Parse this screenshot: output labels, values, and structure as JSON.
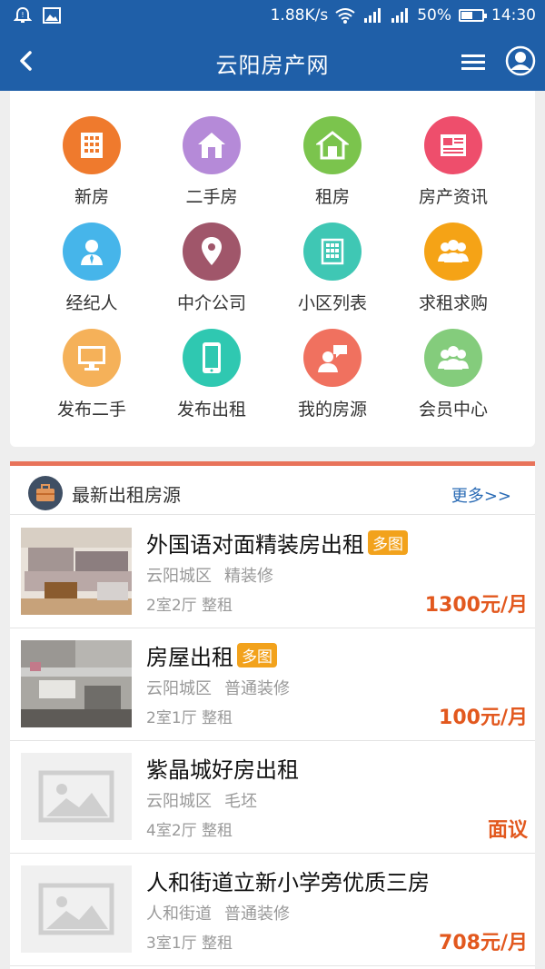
{
  "status": {
    "speed": "1.88K/s",
    "battery": "50%",
    "time": "14:30"
  },
  "header": {
    "title": "云阳房产网"
  },
  "grid": [
    {
      "label": "新房",
      "icon": "building-icon",
      "color": "#ef7a2d"
    },
    {
      "label": "二手房",
      "icon": "house-icon",
      "color": "#b58ad8"
    },
    {
      "label": "租房",
      "icon": "home-icon",
      "color": "#7bc44d"
    },
    {
      "label": "房产资讯",
      "icon": "newspaper-icon",
      "color": "#ee4e6c"
    },
    {
      "label": "经纪人",
      "icon": "agent-icon",
      "color": "#46b5ea"
    },
    {
      "label": "中介公司",
      "icon": "location-pin-icon",
      "color": "#a0566a"
    },
    {
      "label": "小区列表",
      "icon": "grid-building-icon",
      "color": "#3fc7b4"
    },
    {
      "label": "求租求购",
      "icon": "group-icon",
      "color": "#f5a316"
    },
    {
      "label": "发布二手",
      "icon": "monitor-icon",
      "color": "#f5b159"
    },
    {
      "label": "发布出租",
      "icon": "phone-icon",
      "color": "#2fc8b1"
    },
    {
      "label": "我的房源",
      "icon": "chat-person-icon",
      "color": "#f0715f"
    },
    {
      "label": "会员中心",
      "icon": "members-icon",
      "color": "#84cc7c"
    }
  ],
  "rentals": {
    "title": "最新出租房源",
    "more": "更多>>",
    "items": [
      {
        "title": "外国语对面精装房出租",
        "tag": "多图",
        "district": "云阳城区",
        "decor": "精装修",
        "layout": "2室2厅",
        "type": "整租",
        "price": "1300元/月",
        "image": "photo"
      },
      {
        "title": "房屋出租",
        "tag": "多图",
        "district": "云阳城区",
        "decor": "普通装修",
        "layout": "2室1厅",
        "type": "整租",
        "price": "100元/月",
        "image": "photo"
      },
      {
        "title": "紫晶城好房出租",
        "tag": "",
        "district": "云阳城区",
        "decor": "毛坯",
        "layout": "4室2厅",
        "type": "整租",
        "price": "面议",
        "image": "placeholder"
      },
      {
        "title": "人和街道立新小学旁优质三房",
        "tag": "",
        "district": "人和街道",
        "decor": "普通装修",
        "layout": "3室1厅",
        "type": "整租",
        "price": "708元/月",
        "image": "placeholder"
      }
    ]
  }
}
